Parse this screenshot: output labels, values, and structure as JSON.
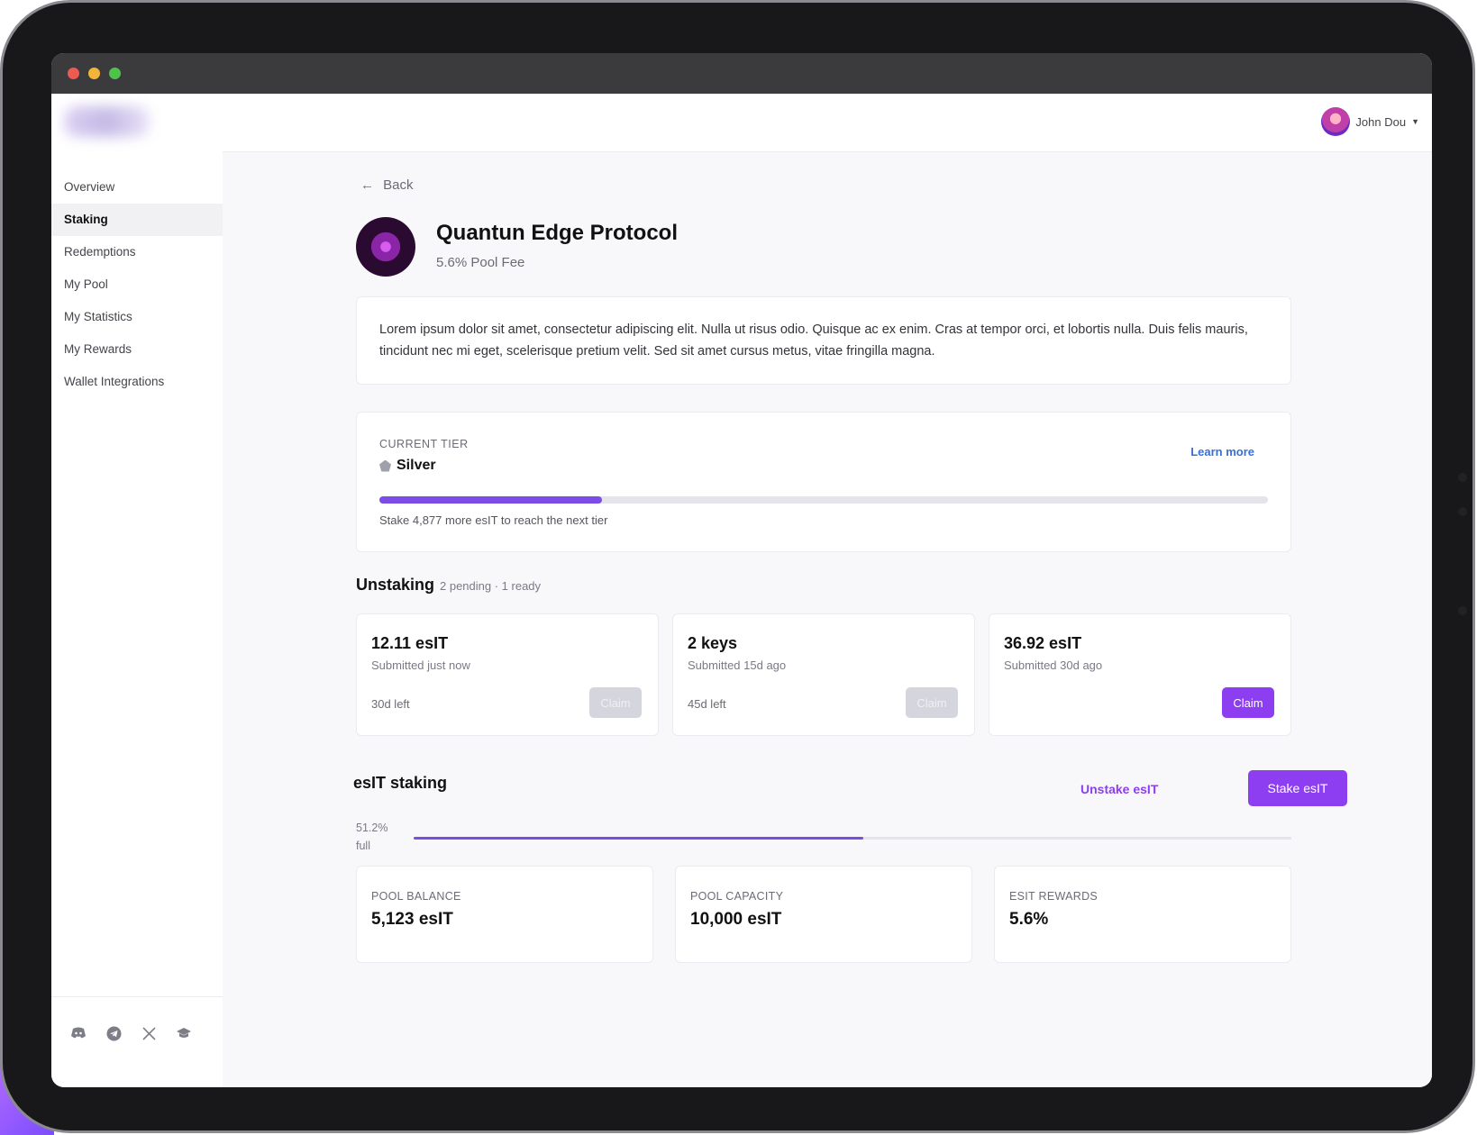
{
  "user": {
    "name": "John Dou"
  },
  "sidebar": {
    "items": [
      {
        "label": "Overview",
        "active": false
      },
      {
        "label": "Staking",
        "active": true
      },
      {
        "label": "Redemptions",
        "active": false
      },
      {
        "label": "My Pool",
        "active": false
      },
      {
        "label": "My Statistics",
        "active": false
      },
      {
        "label": "My Rewards",
        "active": false
      },
      {
        "label": "Wallet Integrations",
        "active": false
      }
    ],
    "socials": [
      "discord-icon",
      "telegram-icon",
      "x-icon",
      "docs-icon"
    ]
  },
  "main": {
    "back_label": "Back",
    "protocol": {
      "name": "Quantun Edge Protocol",
      "fee": "5.6% Pool Fee"
    },
    "description": "Lorem ipsum dolor sit amet, consectetur adipiscing elit. Nulla ut risus odio. Quisque ac ex enim. Cras at tempor orci, et lobortis nulla. Duis felis mauris, tincidunt nec mi eget, scelerisque pretium velit. Sed sit amet cursus metus, vitae fringilla magna.",
    "tier": {
      "label": "CURRENT TIER",
      "name": "Silver",
      "learn_more": "Learn more",
      "progress": 0.25,
      "note": "Stake 4,877 more esIT to reach the next tier"
    },
    "unstaking": {
      "title": "Unstaking",
      "meta": "2 pending · 1 ready",
      "cards": [
        {
          "amount": "12.11 esIT",
          "submitted": "Submitted just now",
          "left": "30d left",
          "claim": "Claim",
          "ready": false
        },
        {
          "amount": "2 keys",
          "submitted": "Submitted 15d ago",
          "left": "45d left",
          "claim": "Claim",
          "ready": false
        },
        {
          "amount": "36.92 esIT",
          "submitted": "Submitted 30d ago",
          "left": "",
          "claim": "Claim",
          "ready": true
        }
      ]
    },
    "staking": {
      "title": "esIT staking",
      "unstake_label": "Unstake esIT",
      "stake_label": "Stake esIT",
      "fill_percent": "51.2%",
      "fill_suffix": "full",
      "fill_fraction": 0.512,
      "stats": [
        {
          "label": "POOL BALANCE",
          "value": "5,123 esIT"
        },
        {
          "label": "POOL CAPACITY",
          "value": "10,000 esIT"
        },
        {
          "label": "ESIT REWARDS",
          "value": "5.6%"
        }
      ]
    }
  },
  "colors": {
    "accent": "#8d3ef0",
    "progress": "#7b4de6",
    "link": "#3a6fd8"
  }
}
